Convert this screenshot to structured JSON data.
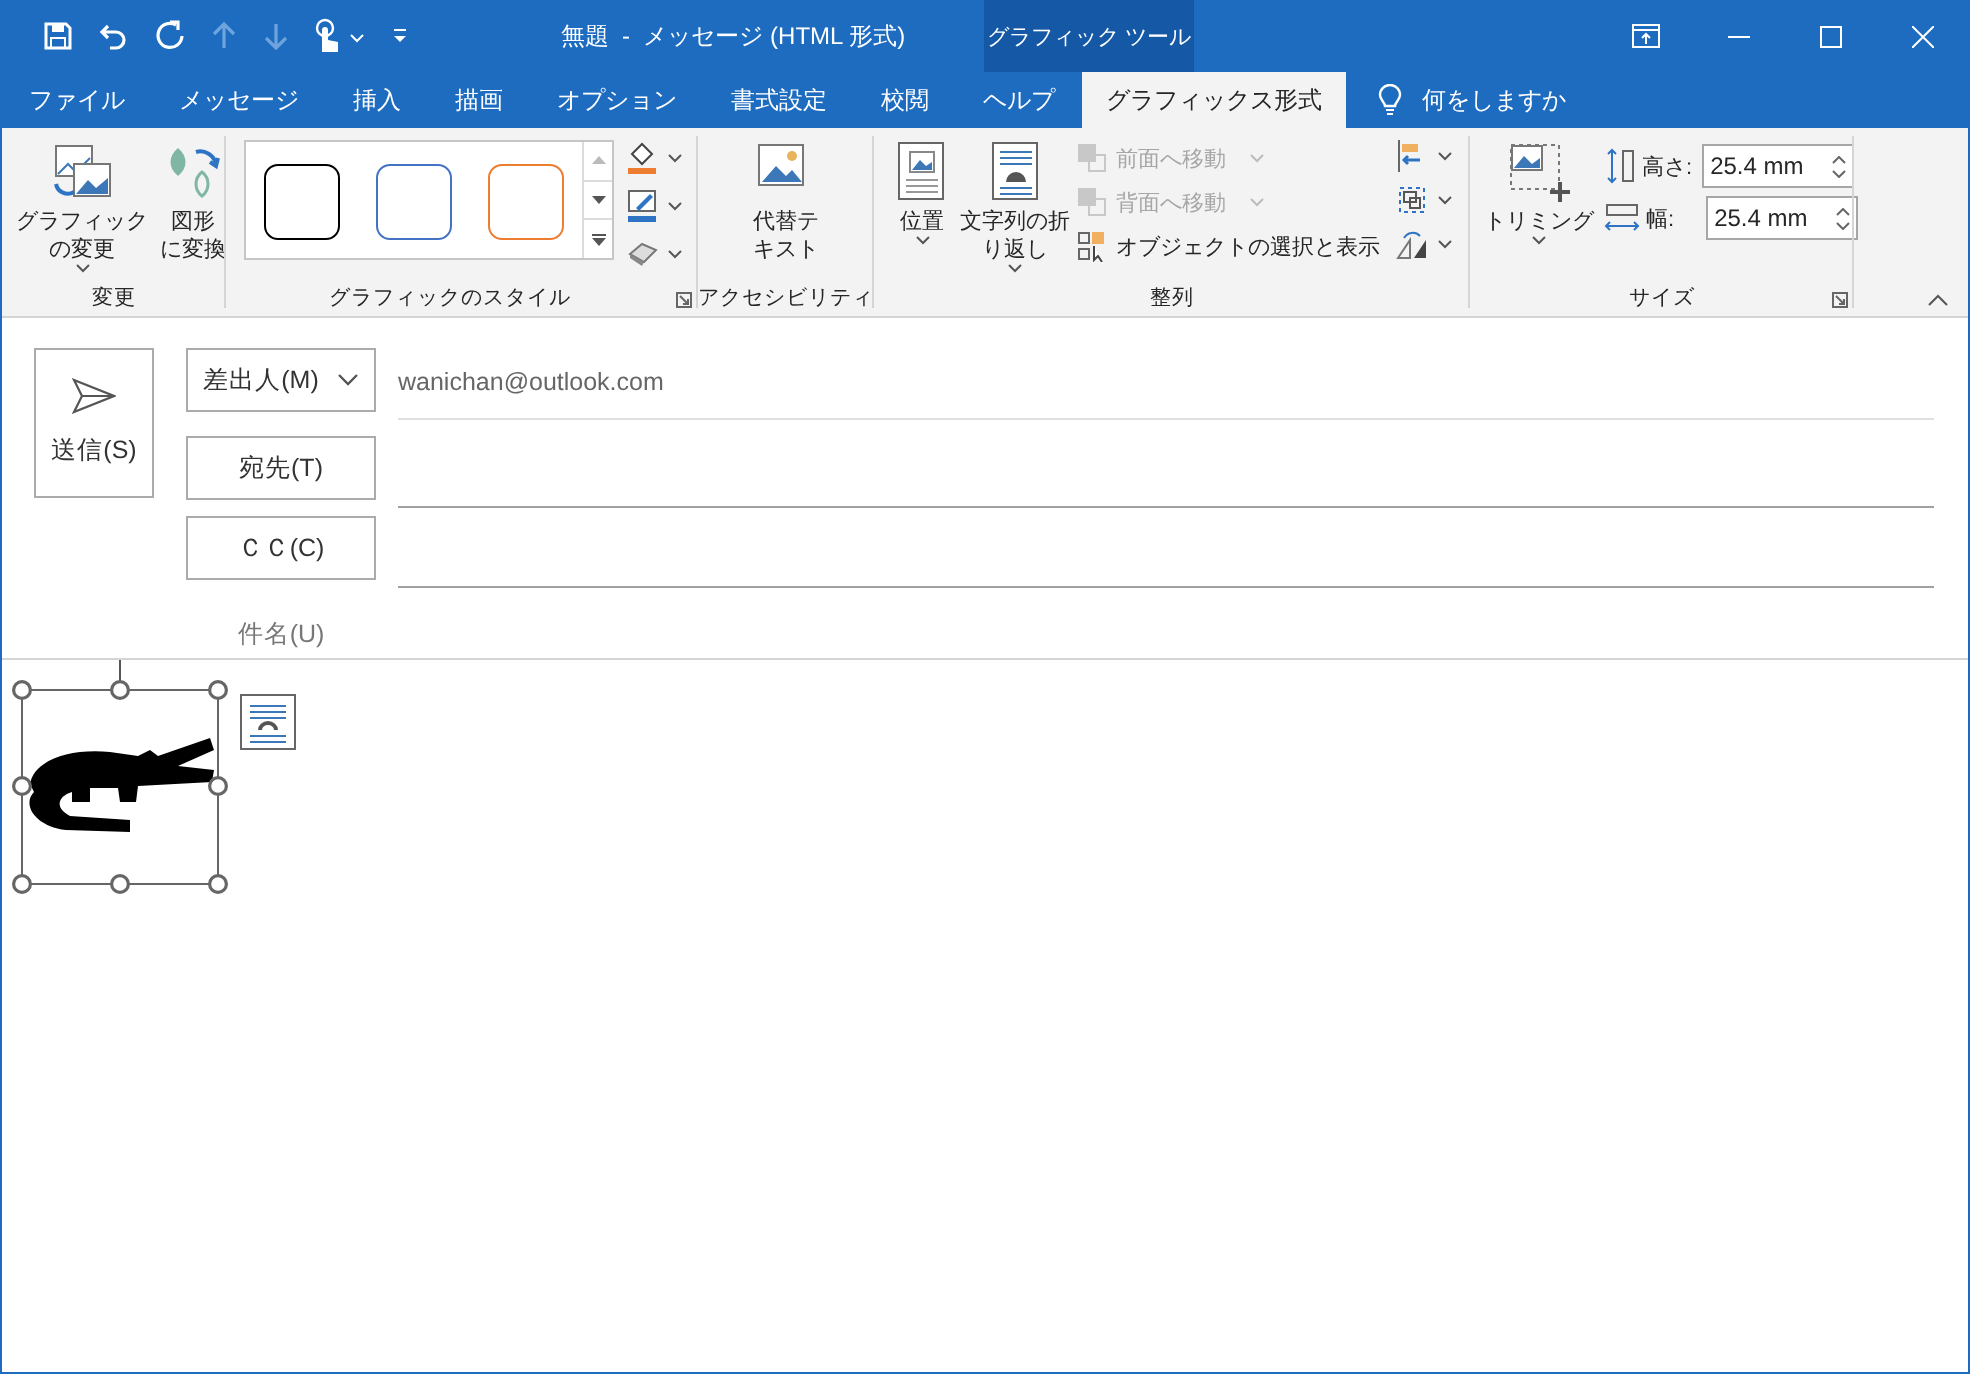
{
  "window": {
    "title": "無題  -  メッセージ (HTML 形式)",
    "context_header": "グラフィック ツール"
  },
  "tabs": [
    {
      "label": "ファイル",
      "selected": false
    },
    {
      "label": "メッセージ",
      "selected": false
    },
    {
      "label": "挿入",
      "selected": false
    },
    {
      "label": "描画",
      "selected": false
    },
    {
      "label": "オプション",
      "selected": false
    },
    {
      "label": "書式設定",
      "selected": false
    },
    {
      "label": "校閲",
      "selected": false
    },
    {
      "label": "ヘルプ",
      "selected": false
    },
    {
      "label": "グラフィックス形式",
      "selected": true
    }
  ],
  "tell_me": "何をしますか",
  "ribbon": {
    "change": {
      "label": "変更",
      "buttons": [
        {
          "lines": [
            "グラフィック",
            "の変更"
          ],
          "dropdown": true
        },
        {
          "lines": [
            "図形",
            "に変換"
          ],
          "dropdown": false
        }
      ]
    },
    "styles": {
      "label": "グラフィックのスタイル",
      "swatches": [
        {
          "color": "#000000"
        },
        {
          "color": "#4472c4"
        },
        {
          "color": "#ed7d31"
        }
      ]
    },
    "accessibility": {
      "label": "アクセシビリティ",
      "button": {
        "lines": [
          "代替テ",
          "キスト"
        ],
        "dropdown": false
      }
    },
    "arrange": {
      "label": "整列",
      "large": [
        {
          "lines": [
            "位置"
          ],
          "dropdown": true
        },
        {
          "lines": [
            "文字列の折",
            "り返し"
          ],
          "dropdown": true
        }
      ],
      "commands": [
        {
          "label": "前面へ移動",
          "disabled": true,
          "dropdown": true
        },
        {
          "label": "背面へ移動",
          "disabled": true,
          "dropdown": true
        },
        {
          "label": "オブジェクトの選択と表示",
          "disabled": false,
          "dropdown": false
        }
      ]
    },
    "size": {
      "label": "サイズ",
      "crop": {
        "lines": [
          "トリミング"
        ],
        "dropdown": true
      },
      "fields": [
        {
          "label": "高さ:",
          "value": "25.4 mm"
        },
        {
          "label": "幅:",
          "value": "25.4 mm"
        }
      ]
    }
  },
  "compose": {
    "send": "送信(S)",
    "from": {
      "button": "差出人(M)",
      "value": "wanichan@outlook.com"
    },
    "to": {
      "button": "宛先(T)"
    },
    "cc": {
      "button": "ＣＣ(C)"
    },
    "subject": {
      "label": "件名(U)"
    }
  }
}
